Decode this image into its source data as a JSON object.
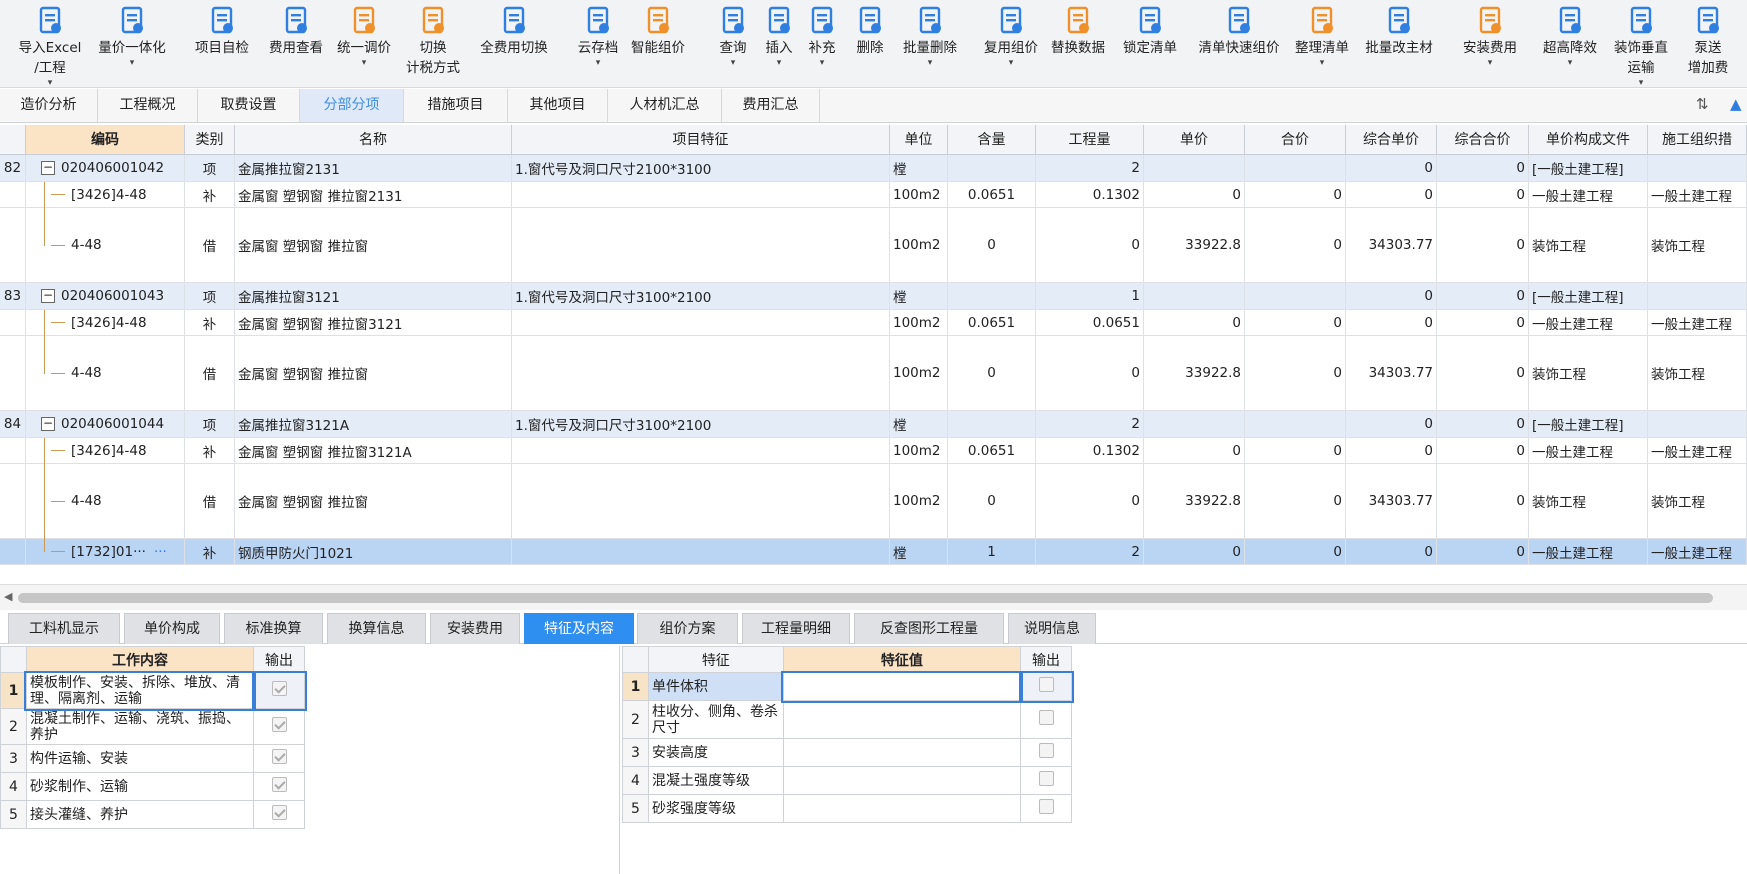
{
  "toolbar": {
    "buttons": [
      {
        "label1": "导入Excel",
        "label2": "/工程",
        "caret": true,
        "icon": "import-excel-icon",
        "color": "#2f7fe0"
      },
      {
        "label1": "量价一体化",
        "label2": "",
        "caret": true,
        "icon": "quantity-price-icon",
        "color": "#2f7fe0"
      },
      {
        "label1": "项目自检",
        "label2": "",
        "caret": false,
        "icon": "project-check-icon",
        "color": "#2f7fe0"
      },
      {
        "label1": "费用查看",
        "label2": "",
        "caret": false,
        "icon": "fee-view-icon",
        "color": "#2f7fe0"
      },
      {
        "label1": "统一调价",
        "label2": "",
        "caret": true,
        "icon": "price-adjust-icon",
        "color": "#f0902a"
      },
      {
        "label1": "切换",
        "label2": "计税方式",
        "caret": false,
        "icon": "tax-switch-icon",
        "color": "#f0902a"
      },
      {
        "label1": "全费用切换",
        "label2": "",
        "caret": false,
        "icon": "full-fee-switch-icon",
        "color": "#2f7fe0"
      },
      {
        "label1": "云存档",
        "label2": "",
        "caret": true,
        "icon": "cloud-save-icon",
        "color": "#2f7fe0"
      },
      {
        "label1": "智能组价",
        "label2": "",
        "caret": false,
        "icon": "smart-price-icon",
        "color": "#f0902a"
      },
      {
        "label1": "查询",
        "label2": "",
        "caret": true,
        "icon": "query-icon",
        "color": "#2f7fe0"
      },
      {
        "label1": "插入",
        "label2": "",
        "caret": true,
        "icon": "insert-icon",
        "color": "#2f7fe0"
      },
      {
        "label1": "补充",
        "label2": "",
        "caret": true,
        "icon": "supplement-icon",
        "color": "#2f7fe0"
      },
      {
        "label1": "删除",
        "label2": "",
        "caret": false,
        "icon": "delete-icon",
        "color": "#2f7fe0"
      },
      {
        "label1": "批量删除",
        "label2": "",
        "caret": true,
        "icon": "batch-delete-icon",
        "color": "#2f7fe0"
      },
      {
        "label1": "复用组价",
        "label2": "",
        "caret": true,
        "icon": "reuse-price-icon",
        "color": "#2f7fe0"
      },
      {
        "label1": "替换数据",
        "label2": "",
        "caret": false,
        "icon": "replace-data-icon",
        "color": "#f0902a"
      },
      {
        "label1": "锁定清单",
        "label2": "",
        "caret": false,
        "icon": "lock-list-icon",
        "color": "#2f7fe0"
      },
      {
        "label1": "清单快速组价",
        "label2": "",
        "caret": false,
        "icon": "quick-price-icon",
        "color": "#2f7fe0"
      },
      {
        "label1": "整理清单",
        "label2": "",
        "caret": true,
        "icon": "organize-list-icon",
        "color": "#f0902a"
      },
      {
        "label1": "批量改主材",
        "label2": "",
        "caret": false,
        "icon": "batch-material-icon",
        "color": "#2f7fe0"
      },
      {
        "label1": "安装费用",
        "label2": "",
        "caret": true,
        "icon": "install-fee-icon",
        "color": "#f0902a"
      },
      {
        "label1": "超高降效",
        "label2": "",
        "caret": true,
        "icon": "high-efficiency-icon",
        "color": "#2f7fe0"
      },
      {
        "label1": "装饰垂直",
        "label2": "运输",
        "caret": true,
        "icon": "vertical-transport-icon",
        "color": "#2f7fe0"
      },
      {
        "label1": "泵送",
        "label2": "增加费",
        "caret": false,
        "icon": "pump-fee-icon",
        "color": "#2f7fe0"
      }
    ]
  },
  "tabs": [
    "造价分析",
    "工程概况",
    "取费设置",
    "分部分项",
    "措施项目",
    "其他项目",
    "人材机汇总",
    "费用汇总"
  ],
  "active_tab": "分部分项",
  "grid": {
    "headers": [
      "",
      "编码",
      "类别",
      "名称",
      "项目特征",
      "单位",
      "含量",
      "工程量",
      "单价",
      "合价",
      "综合单价",
      "综合合价",
      "单价构成文件",
      "施工组织措"
    ],
    "rows": [
      {
        "type": "item",
        "num": "82",
        "code": "020406001042",
        "cat": "项",
        "name": "金属推拉窗2131",
        "feature": "1.窗代号及洞口尺寸2100*3100",
        "unit": "樘",
        "content": "",
        "qty": "2",
        "price": "",
        "total": "",
        "uprice": "0",
        "utotal": "0",
        "file": "[一般土建工程]",
        "org": ""
      },
      {
        "type": "sub",
        "num": "",
        "code": "[3426]4-48",
        "cat": "补",
        "name": "金属窗 塑钢窗 推拉窗2131",
        "feature": "",
        "unit": "100m2",
        "content": "0.0651",
        "qty": "0.1302",
        "price": "0",
        "total": "0",
        "uprice": "0",
        "utotal": "0",
        "file": "一般土建工程",
        "org": "一般土建工程"
      },
      {
        "type": "tall",
        "num": "",
        "code": "4-48",
        "cat": "借",
        "name": "金属窗 塑钢窗 推拉窗",
        "feature": "",
        "unit": "100m2",
        "content": "0",
        "qty": "0",
        "price": "33922.8",
        "total": "0",
        "uprice": "34303.77",
        "utotal": "0",
        "file": "装饰工程",
        "org": "装饰工程"
      },
      {
        "type": "item",
        "num": "83",
        "code": "020406001043",
        "cat": "项",
        "name": "金属推拉窗3121",
        "feature": "1.窗代号及洞口尺寸3100*2100",
        "unit": "樘",
        "content": "",
        "qty": "1",
        "price": "",
        "total": "",
        "uprice": "0",
        "utotal": "0",
        "file": "[一般土建工程]",
        "org": ""
      },
      {
        "type": "sub",
        "num": "",
        "code": "[3426]4-48",
        "cat": "补",
        "name": "金属窗 塑钢窗 推拉窗3121",
        "feature": "",
        "unit": "100m2",
        "content": "0.0651",
        "qty": "0.0651",
        "price": "0",
        "total": "0",
        "uprice": "0",
        "utotal": "0",
        "file": "一般土建工程",
        "org": "一般土建工程"
      },
      {
        "type": "tall",
        "num": "",
        "code": "4-48",
        "cat": "借",
        "name": "金属窗 塑钢窗 推拉窗",
        "feature": "",
        "unit": "100m2",
        "content": "0",
        "qty": "0",
        "price": "33922.8",
        "total": "0",
        "uprice": "34303.77",
        "utotal": "0",
        "file": "装饰工程",
        "org": "装饰工程"
      },
      {
        "type": "item",
        "num": "84",
        "code": "020406001044",
        "cat": "项",
        "name": "金属推拉窗3121A",
        "feature": "1.窗代号及洞口尺寸3100*2100",
        "unit": "樘",
        "content": "",
        "qty": "2",
        "price": "",
        "total": "",
        "uprice": "0",
        "utotal": "0",
        "file": "[一般土建工程]",
        "org": ""
      },
      {
        "type": "sub",
        "num": "",
        "code": "[3426]4-48",
        "cat": "补",
        "name": "金属窗 塑钢窗 推拉窗3121A",
        "feature": "",
        "unit": "100m2",
        "content": "0.0651",
        "qty": "0.1302",
        "price": "0",
        "total": "0",
        "uprice": "0",
        "utotal": "0",
        "file": "一般土建工程",
        "org": "一般土建工程"
      },
      {
        "type": "tall",
        "num": "",
        "code": "4-48",
        "cat": "借",
        "name": "金属窗 塑钢窗 推拉窗",
        "feature": "",
        "unit": "100m2",
        "content": "0",
        "qty": "0",
        "price": "33922.8",
        "total": "0",
        "uprice": "34303.77",
        "utotal": "0",
        "file": "装饰工程",
        "org": "装饰工程"
      },
      {
        "type": "sel",
        "num": "",
        "code": "[1732]01···",
        "cat": "补",
        "name": "钢质甲防火门1021",
        "feature": "",
        "unit": "樘",
        "content": "1",
        "qty": "2",
        "price": "0",
        "total": "0",
        "uprice": "0",
        "utotal": "0",
        "file": "一般土建工程",
        "org": "一般土建工程"
      }
    ]
  },
  "bottom_tabs": [
    "工料机显示",
    "单价构成",
    "标准换算",
    "换算信息",
    "安装费用",
    "特征及内容",
    "组价方案",
    "工程量明细",
    "反查图形工程量",
    "说明信息"
  ],
  "active_bottom_tab": "特征及内容",
  "work_content": {
    "headers": [
      "工作内容",
      "输出"
    ],
    "rows": [
      {
        "num": "1",
        "text": "模板制作、安装、拆除、堆放、清理、隔离剂、运输",
        "checked": true
      },
      {
        "num": "2",
        "text": "混凝土制作、运输、浇筑、振捣、养护",
        "checked": true
      },
      {
        "num": "3",
        "text": "构件运输、安装",
        "checked": true
      },
      {
        "num": "4",
        "text": "砂浆制作、运输",
        "checked": true
      },
      {
        "num": "5",
        "text": "接头灌缝、养护",
        "checked": true
      }
    ]
  },
  "features": {
    "headers": [
      "特征",
      "特征值",
      "输出"
    ],
    "rows": [
      {
        "num": "1",
        "text": "单件体积",
        "value": "",
        "checked": false
      },
      {
        "num": "2",
        "text": "柱收分、侧角、卷杀尺寸",
        "value": "",
        "checked": false
      },
      {
        "num": "3",
        "text": "安装高度",
        "value": "",
        "checked": false
      },
      {
        "num": "4",
        "text": "混凝土强度等级",
        "value": "",
        "checked": false
      },
      {
        "num": "5",
        "text": "砂浆强度等级",
        "value": "",
        "checked": false
      }
    ]
  }
}
